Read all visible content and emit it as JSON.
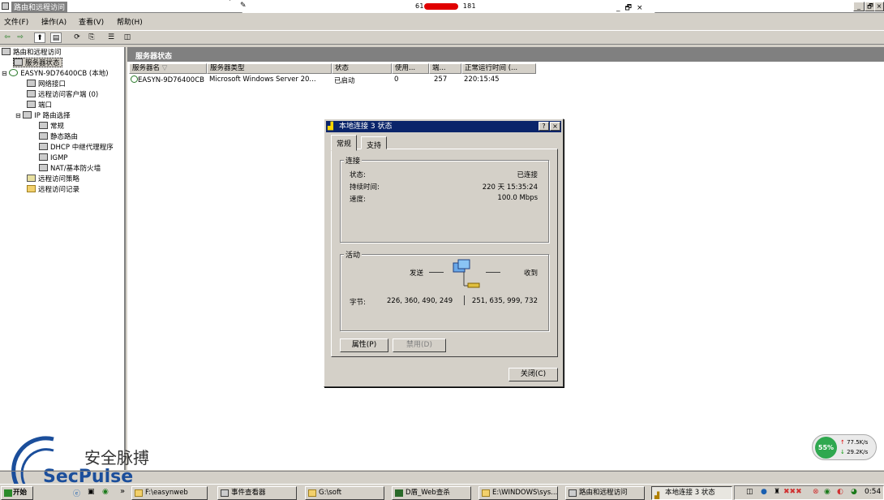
{
  "window": {
    "title": "路由和远程访问",
    "rdp_host_prefix": "61",
    "rdp_host_suffix": "181",
    "min_label": "_",
    "restore_label": "🗗",
    "close_label": "×"
  },
  "menu": [
    "文件(F)",
    "操作(A)",
    "查看(V)",
    "帮助(H)"
  ],
  "tree": {
    "root": "路由和远程访问",
    "server_status": "服务器状态",
    "server": "EASYN-9D76400CB (本地)",
    "children": [
      "网络接口",
      "远程访问客户端 (0)",
      "端口",
      "IP 路由选择"
    ],
    "ip_children": [
      "常规",
      "静态路由",
      "DHCP 中继代理程序",
      "IGMP",
      "NAT/基本防火墙"
    ],
    "tail": [
      "远程访问策略",
      "远程访问记录"
    ]
  },
  "pane": {
    "header": "服务器状态",
    "columns": [
      "服务器名",
      "服务器类型",
      "状态",
      "使用...",
      "端...",
      "正常运行时间 (..."
    ],
    "rows": [
      [
        "EASYN-9D76400CB",
        "Microsoft Windows Server 20...",
        "已启动",
        "0",
        "257",
        "220:15:45"
      ]
    ]
  },
  "dialog": {
    "title": "本地连接 3 状态",
    "help": "?",
    "close": "×",
    "tabs": [
      "常规",
      "支持"
    ],
    "connection": {
      "group": "连接",
      "status_label": "状态:",
      "status_value": "已连接",
      "duration_label": "持续时间:",
      "duration_value": "220 天 15:35:24",
      "speed_label": "速度:",
      "speed_value": "100.0 Mbps"
    },
    "activity": {
      "group": "活动",
      "sent": "发送",
      "received": "收到",
      "bytes_label": "字节:",
      "bytes_sent": "226, 360, 490, 249",
      "bytes_received": "251, 635, 999, 732"
    },
    "properties_btn": "属性(P)",
    "disable_btn": "禁用(D)",
    "close_btn": "关闭(C)"
  },
  "watermark": {
    "cn": "安全脉搏",
    "en": "SecPulse"
  },
  "netgauge": {
    "percent": "55%",
    "up": "77.5K/s",
    "down": "29.2K/s"
  },
  "taskbar": {
    "start": "开始",
    "more": "»",
    "tasks": [
      "F:\\easynweb",
      "事件查看器",
      "G:\\soft",
      "D盾_Web查杀",
      "E:\\WINDOWS\\sys...",
      "路由和远程访问",
      "本地连接 3 状态"
    ],
    "clock": "0:54"
  }
}
